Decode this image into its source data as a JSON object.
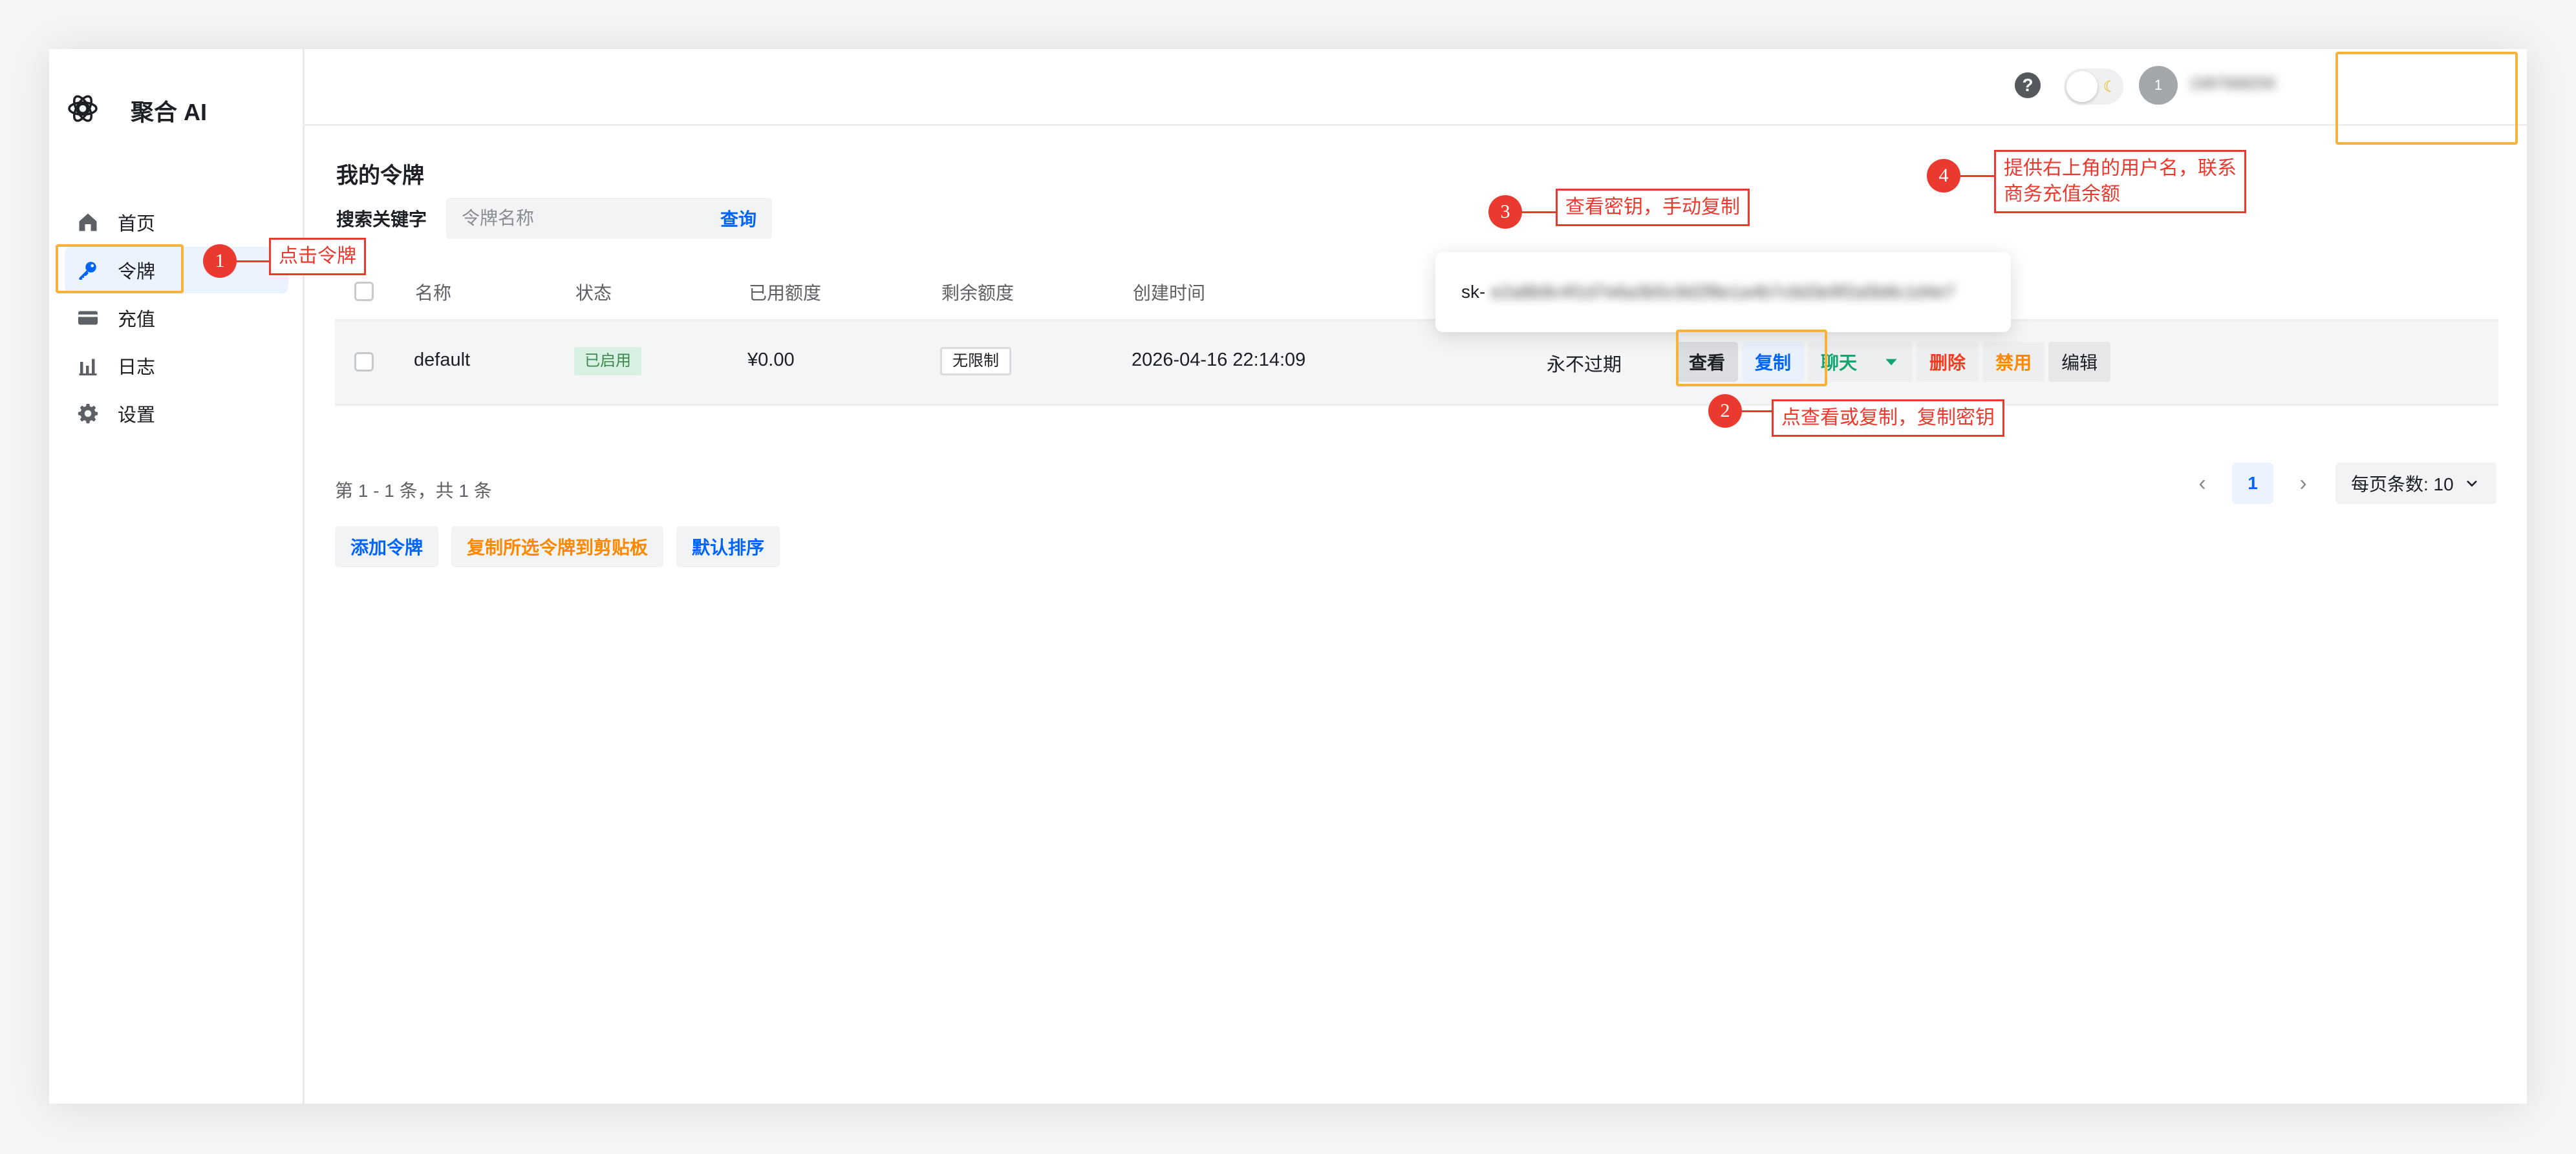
{
  "app": {
    "brand": "聚合 AI"
  },
  "sidebar": {
    "items": [
      {
        "label": "首页",
        "icon": "home-icon"
      },
      {
        "label": "令牌",
        "icon": "key-icon",
        "active": true
      },
      {
        "label": "充值",
        "icon": "credit-card-icon"
      },
      {
        "label": "日志",
        "icon": "bar-chart-icon"
      },
      {
        "label": "设置",
        "icon": "gear-icon"
      }
    ]
  },
  "header": {
    "help": "?",
    "avatar_initial": "1",
    "username": "1587568255"
  },
  "main": {
    "title": "我的令牌",
    "search_label": "搜索关键字",
    "search_placeholder": "令牌名称",
    "query_button": "查询",
    "table": {
      "columns": [
        "名称",
        "状态",
        "已用额度",
        "剩余额度",
        "创建时间"
      ],
      "rows": [
        {
          "name": "default",
          "status": "已启用",
          "used": "¥0.00",
          "remaining": "无限制",
          "created": "2026-04-16 22:14:09",
          "expires": "永不过期",
          "actions": {
            "view": "查看",
            "copy": "复制",
            "chat": "聊天",
            "delete": "删除",
            "disable": "禁用",
            "edit": "编辑"
          }
        }
      ]
    },
    "pagination": {
      "info": "第 1 - 1 条，共 1 条",
      "current_page": "1",
      "page_size_label": "每页条数: 10"
    },
    "bottom_actions": {
      "add": "添加令牌",
      "copy_selected": "复制所选令牌到剪贴板",
      "default_sort": "默认排序"
    },
    "popover": {
      "key_prefix": "sk-",
      "key_rest": "e2a8b9c4f1d7e6a3b5c9d2f8e1a4b7c6d3e9f2a5b8c1d4e7"
    }
  },
  "annotations": [
    {
      "num": "1",
      "text": "点击令牌"
    },
    {
      "num": "2",
      "text": "点查看或复制，复制密钥"
    },
    {
      "num": "3",
      "text": "查看密钥，手动复制"
    },
    {
      "num": "4",
      "text_line1": "提供右上角的用户名，联系",
      "text_line2": "商务充值余额"
    }
  ],
  "colors": {
    "accent": "#0064fa",
    "annotation": "#ea3a2f",
    "highlight": "#f5b33d"
  }
}
